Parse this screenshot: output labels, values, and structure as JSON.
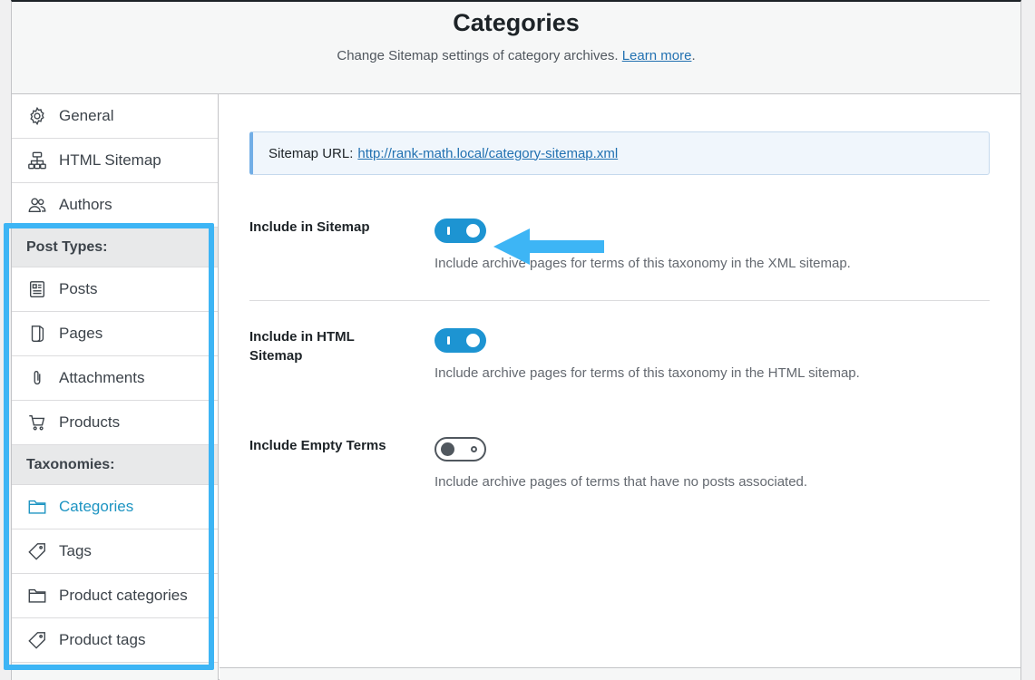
{
  "header": {
    "title": "Categories",
    "description": "Change Sitemap settings of category archives.",
    "learn_more": "Learn more",
    "period": "."
  },
  "sidebar": {
    "top_items": [
      {
        "label": "General",
        "icon": "gear-icon"
      },
      {
        "label": "HTML Sitemap",
        "icon": "sitemap-icon"
      },
      {
        "label": "Authors",
        "icon": "users-icon"
      }
    ],
    "post_types_heading": "Post Types:",
    "post_types": [
      {
        "label": "Posts",
        "icon": "post-icon"
      },
      {
        "label": "Pages",
        "icon": "page-icon"
      },
      {
        "label": "Attachments",
        "icon": "paperclip-icon"
      },
      {
        "label": "Products",
        "icon": "cart-icon"
      }
    ],
    "taxonomies_heading": "Taxonomies:",
    "taxonomies": [
      {
        "label": "Categories",
        "icon": "folder-icon",
        "active": true
      },
      {
        "label": "Tags",
        "icon": "tag-icon"
      },
      {
        "label": "Product categories",
        "icon": "folder-icon"
      },
      {
        "label": "Product tags",
        "icon": "tag-icon"
      }
    ],
    "highlight_color": "#3db5f5",
    "active_color": "#1d94c2"
  },
  "notice": {
    "prefix": "Sitemap URL:",
    "url": "http://rank-math.local/category-sitemap.xml"
  },
  "settings": [
    {
      "label": "Include in Sitemap",
      "enabled": true,
      "description": "Include archive pages for terms of this taxonomy in the XML sitemap."
    },
    {
      "label": "Include in HTML Sitemap",
      "enabled": true,
      "description": "Include archive pages for terms of this taxonomy in the HTML sitemap."
    },
    {
      "label": "Include Empty Terms",
      "enabled": false,
      "description": "Include archive pages of terms that have no posts associated."
    }
  ],
  "toggle_on_color": "#1d94d2",
  "annotation_arrow_color": "#3db5f5"
}
